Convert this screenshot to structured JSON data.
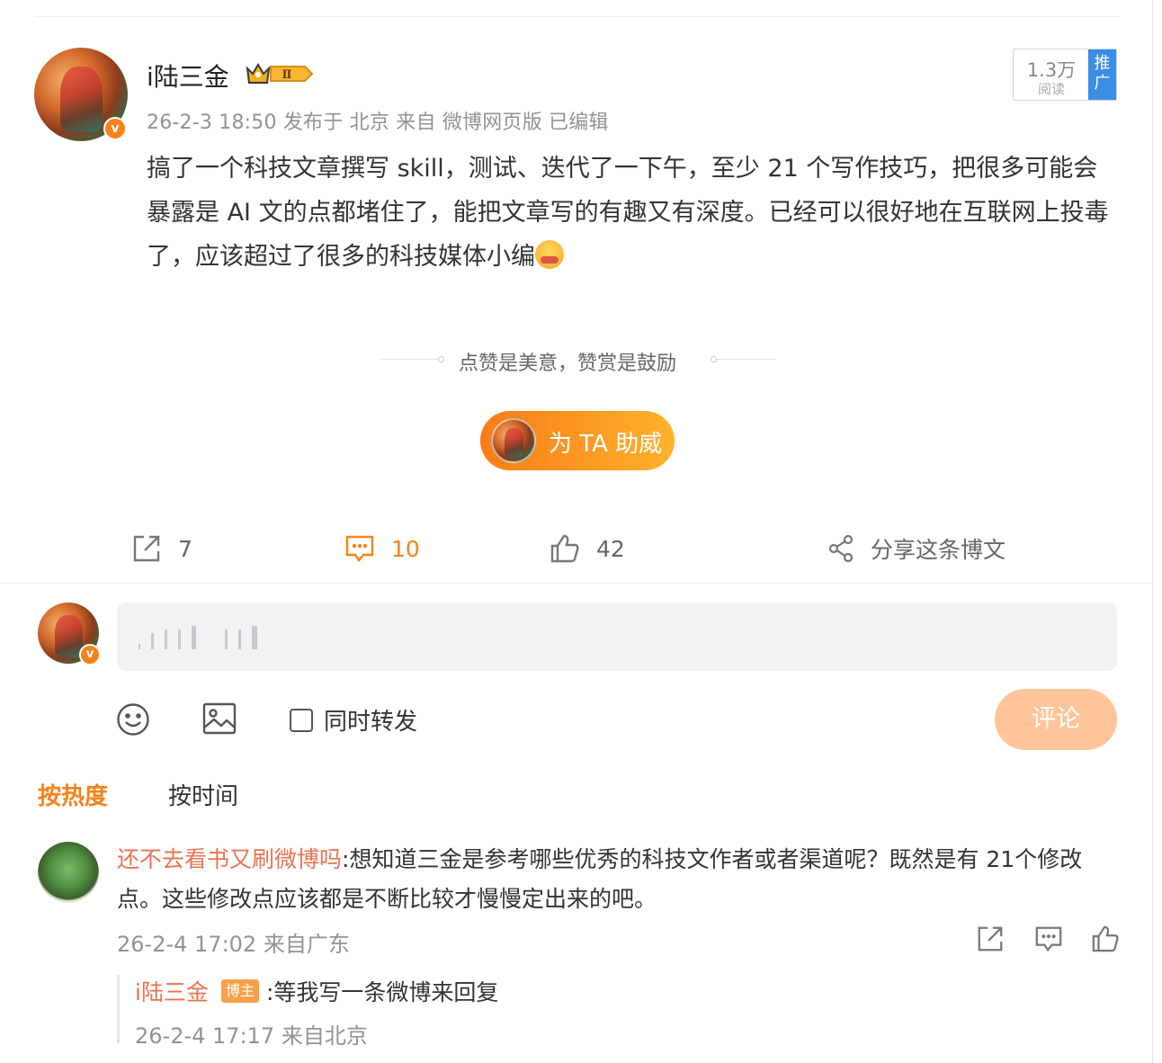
{
  "post": {
    "author": "i陆三金",
    "level_badge": "Ⅱ",
    "meta": "26-2-3 18:50 发布于 北京 来自 微博网页版 已编辑",
    "text": "搞了一个科技文章撰写 skill，测试、迭代了一下午，至少 21 个写作技巧，把很多可能会暴露是 AI 文的点都堵住了，能把文章写的有趣又有深度。已经可以很好地在互联网上投毒了，应该超过了很多的科技媒体小编",
    "reads": "1.3万",
    "reads_label": "阅读",
    "promote_label": "推广"
  },
  "support": {
    "slogan": "点赞是美意，赞赏是鼓励",
    "button": "为 TA 助威"
  },
  "actions": {
    "repost_count": "7",
    "comment_count": "10",
    "like_count": "42",
    "share_label": "分享这条博文"
  },
  "compose": {
    "also_repost_label": "同时转发",
    "submit_label": "评论"
  },
  "sort": {
    "hot": "按热度",
    "time": "按时间"
  },
  "comment": {
    "user": "还不去看书又刷微博吗",
    "sep": ":",
    "text": "想知道三金是参考哪些优秀的科技文作者或者渠道呢？既然是有 21个修改点。这些修改点应该都是不断比较才慢慢定出来的吧。",
    "meta": "26-2-4 17:02 来自广东"
  },
  "reply": {
    "user": "i陆三金",
    "tag": "博主",
    "text": ":等我写一条微博来回复",
    "meta": "26-2-4 17:17 来自北京"
  },
  "colors": {
    "accent": "#f7821a",
    "link_user": "#eb7350",
    "promote_blue": "#3a8ee6"
  }
}
